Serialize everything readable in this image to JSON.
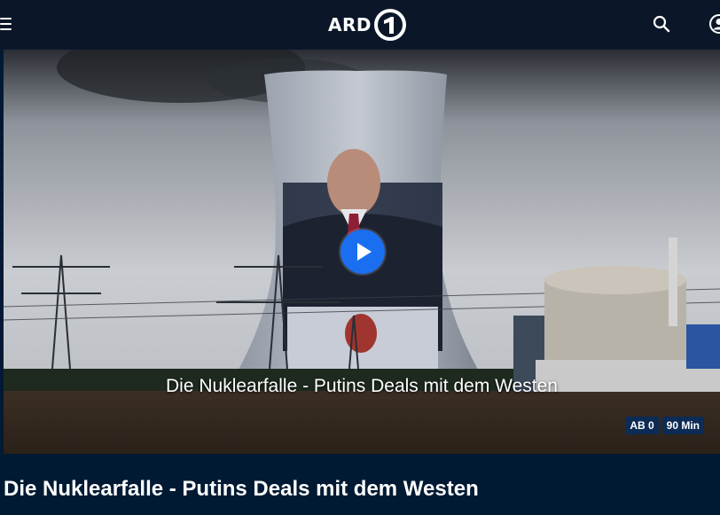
{
  "header": {
    "logo_text": "ARD",
    "logo_numeral": "1",
    "icons": [
      "menu-icon",
      "search-icon",
      "account-icon"
    ]
  },
  "hero": {
    "caption": "Die Nuklearfalle - Putins Deals mit dem Westen",
    "badges": {
      "age": "AB 0",
      "duration": "90 Min"
    },
    "play_icon": "play-icon"
  },
  "main": {
    "title": "Die Nuklearfalle - Putins Deals mit dem Westen"
  },
  "colors": {
    "header_bg": "#0b1729",
    "page_bg": "#001a33",
    "accent": "#1a6ff0",
    "badge_bg": "#0d2c55"
  }
}
